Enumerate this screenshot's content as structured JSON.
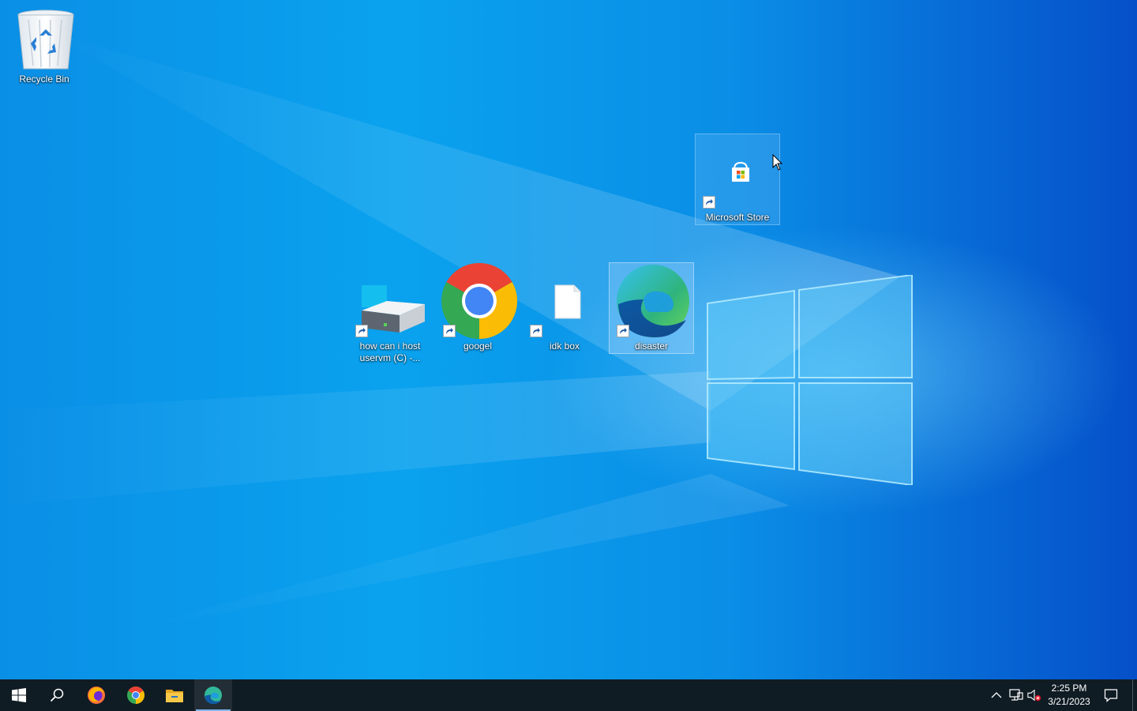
{
  "desktop": {
    "icons": [
      {
        "label": "Recycle Bin",
        "icon": "recycle-bin-icon",
        "shortcut": false
      },
      {
        "label": "Microsoft Store",
        "icon": "microsoft-store-icon",
        "shortcut": true
      },
      {
        "label": "how can i host uservm (C) -...",
        "icon": "drive-icon",
        "shortcut": true
      },
      {
        "label": "googel",
        "icon": "chrome-icon",
        "shortcut": true
      },
      {
        "label": "idk box",
        "icon": "file-icon",
        "shortcut": true
      },
      {
        "label": "disaster",
        "icon": "edge-icon",
        "shortcut": true
      }
    ]
  },
  "taskbar": {
    "pinned": [
      {
        "name": "start",
        "icon": "windows-start-icon"
      },
      {
        "name": "search",
        "icon": "search-icon"
      },
      {
        "name": "firefox",
        "icon": "firefox-icon"
      },
      {
        "name": "chrome",
        "icon": "chrome-icon"
      },
      {
        "name": "file-explorer",
        "icon": "folder-icon"
      },
      {
        "name": "edge",
        "icon": "edge-icon",
        "active": true
      }
    ],
    "tray": {
      "icons": [
        "chevron-up-icon",
        "network-icon",
        "volume-muted-icon"
      ],
      "time": "2:25 PM",
      "date": "3/21/2023",
      "notification_icon": "action-center-icon"
    }
  },
  "colors": {
    "taskbar": "#101c24",
    "desktop_blue": "#0a9ef0",
    "active_indicator": "#7fb7ea"
  }
}
